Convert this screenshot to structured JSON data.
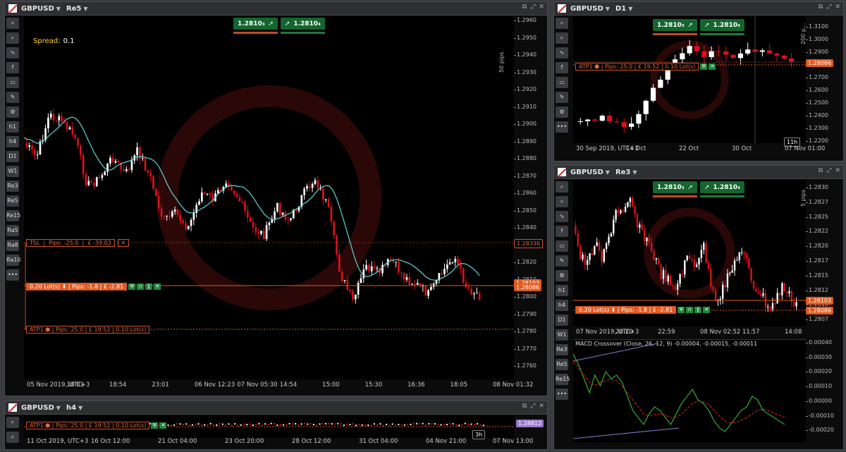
{
  "main": {
    "symbol": "GBPUSD",
    "timeframe": "Re5",
    "spread_label": "Spread:",
    "spread_value": "0.1",
    "sell_price": "1.2810₃",
    "buy_price": "1.2810₄",
    "range_label": "50 pips",
    "yticks": [
      "1.2960",
      "1.2950",
      "1.2940",
      "1.2930",
      "1.2920",
      "1.2910",
      "1.2900",
      "1.2890",
      "1.2880",
      "1.2870",
      "1.2860",
      "1.2850",
      "1.2840",
      "1.2830",
      "1.2820",
      "1.2810",
      "1.2800",
      "1.2790",
      "1.2780",
      "1.2770",
      "1.2760"
    ],
    "xticks": [
      "05 Nov 2019, UTC+3",
      "18:01",
      "18:54",
      "23:01",
      "06 Nov 12:23",
      "07 Nov 05:30",
      "14:54",
      "15:00",
      "15:30",
      "16:36",
      "18:05",
      "08 Nov 01:32"
    ],
    "tsl": {
      "name": "TSL",
      "pips": "Pips: -25.0",
      "pnl": "£ -39.03",
      "close": "✕",
      "price": "1.28336"
    },
    "position": {
      "lots": "0.20 Lot(s)",
      "pips": "Pips: -1.8",
      "pnl": "£ -2.81",
      "price": "1.28086",
      "current": "1.28103"
    },
    "atp": {
      "name": "ATP1",
      "pips": "Pips: 25.0",
      "pnl": "£ 19.52",
      "lots": "0.10 Lot(s)"
    },
    "side_buttons": [
      "h1",
      "h4",
      "D1",
      "W1",
      "Re3",
      "Re5",
      "Re15",
      "Ra5",
      "Ra8",
      "Ra10"
    ]
  },
  "d1": {
    "symbol": "GBPUSD",
    "timeframe": "D1",
    "sell_price": "1.2810₃",
    "buy_price": "1.2810₄",
    "range_label": "200 p...",
    "yticks": [
      "1.3100",
      "1.3000",
      "1.2900",
      "1.2800",
      "1.2700",
      "1.2600",
      "1.2500",
      "1.2400",
      "1.2300",
      "1.2200"
    ],
    "xticks": [
      "30 Sep 2019, UTC+3",
      "14 Oct",
      "22 Oct",
      "30 Oct",
      "07 Nov 01:00"
    ],
    "atp": {
      "name": "ATP1",
      "pips": "Pips: 25.0",
      "pnl": "£ 19.52",
      "lots": "0.10 Lot(s)"
    },
    "price": "1.28086",
    "countdown": "11h"
  },
  "re3": {
    "symbol": "GBPUSD",
    "timeframe": "Re3",
    "sell_price": "1.2810₃",
    "buy_price": "1.2810₄",
    "range_label": "5 pips",
    "yticks": [
      "1.2830",
      "1.2827",
      "1.2825",
      "1.2822",
      "1.2820",
      "1.2817",
      "1.2815",
      "1.2812",
      "1.2810",
      "1.2807"
    ],
    "xticks": [
      "07 Nov 2019, UTC+3",
      "20:20",
      "22:59",
      "08 Nov 02:52",
      "11:57",
      "14:08"
    ],
    "position": {
      "lots": "0.20 Lot(s)",
      "pips": "Pips: -1.8",
      "pnl": "£ -2.81",
      "price": "1.28086",
      "current": "1.28103"
    },
    "macd_label": "MACD Crossover (Close, 26, 12, 9) -0.00004, -0.00015, -0.00011",
    "macd_yticks": [
      "0.00040",
      "0.00030",
      "0.00020",
      "0.00010",
      "0.00000",
      "-0.00010",
      "-0.00020"
    ],
    "side_buttons": [
      "h1",
      "h4",
      "D1",
      "W1",
      "Re3",
      "Re5",
      "Re15"
    ]
  },
  "h4": {
    "symbol": "GBPUSD",
    "timeframe": "h4",
    "atp": {
      "name": "ATP1",
      "pips": "Pips: 25.0",
      "pnl": "£ 19.52",
      "lots": "0.10 Lot(s)"
    },
    "price": "1.28812",
    "countdown": "3h",
    "xticks": [
      "11 Oct 2019, UTC+3",
      "16 Oct 12:00",
      "21 Oct 04:00",
      "23 Oct 20:00",
      "28 Oct 12:00",
      "31 Oct 04:00",
      "04 Nov 21:00",
      "07 Nov 13:00"
    ]
  },
  "icons": [
    "zoom-icon",
    "zoom-out-icon",
    "indicator-icon",
    "facebook-icon",
    "chart-type-icon",
    "drawing-icon",
    "settings-icon",
    "more-icon"
  ],
  "colors": {
    "bull": "#ffffff",
    "bear": "#d8121a",
    "ma": "#5fd6d6",
    "accent": "#e05a20",
    "buy": "#14652e"
  }
}
